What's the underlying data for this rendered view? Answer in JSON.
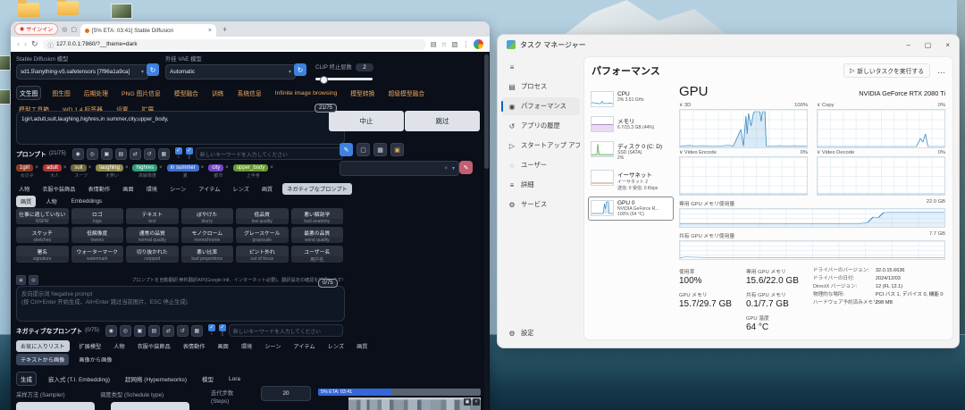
{
  "glyphs": {
    "back": "‹",
    "forward": "›",
    "reload": "↻",
    "info": "ⓘ",
    "star": "☆",
    "panel": "▤",
    "ext": "▧",
    "menu": "⋮",
    "plus": "+",
    "close": "×",
    "person": "◉",
    "circle": "◎",
    "box": "▢",
    "min": "–",
    "max": "▢",
    "hamburger": "≡",
    "gear": "⚙",
    "ellipsis": "…",
    "runtask": "▷",
    "check": "✓",
    "brush": "✎",
    "trash": "▦",
    "image": "▣",
    "swap": "⇄",
    "undo": "↺",
    "collapse": "◠",
    "expand": "▣"
  },
  "browser": {
    "signin_label": "サインイン",
    "tab_title": "[5% ETA: 03:41] Stable Diffusion",
    "url": "127.0.0.1:7860/?__theme=dark"
  },
  "sd": {
    "model_label": "Stable Diffusion 模型",
    "model_value": "sd1.5\\anything-v5.safetensors [7f96a1a9ca]",
    "vae_label": "外挂 VAE 模型",
    "vae_value": "Automatic",
    "clip_label": "CLIP 终止层数",
    "clip_value": "2",
    "tabs": [
      "文生图",
      "图生图",
      "后期处理",
      "PNG 图片信息",
      "模型融合",
      "训练",
      "系统信息",
      "Infinite image browsing",
      "模型转换",
      "超级模型融合",
      "模型工具箱",
      "WD 1.4 标签器",
      "设置",
      "扩展"
    ],
    "prompt_counter": "21/75",
    "prompt_text": "1girl,adult,suit,laughing,highres,in summer,city,upper_body,",
    "interrupt_label": "中止",
    "skip_label": "跳过",
    "prompt_header": "プロンプト",
    "prompt_header_count": "(21/75)",
    "neg_header": "ネガティブなプロンプト",
    "neg_header_count": "(0/75)",
    "keyword_placeholder": "新しいキーワードを入力してください",
    "header_icons": [
      "◉",
      "◎",
      "▣",
      "▤",
      "⇄",
      "↺",
      "▦"
    ],
    "toggles": [
      {
        "glyph": "○"
      },
      {
        "glyph": "▯"
      }
    ],
    "chips": [
      {
        "label": "1girl",
        "sub": "女の子",
        "color": "#8c3a28"
      },
      {
        "label": "adult",
        "sub": "大人",
        "color": "#b23434"
      },
      {
        "label": "suit",
        "sub": "スーツ",
        "color": "#6e6638"
      },
      {
        "label": "laughing",
        "sub": "大笑い",
        "color": "#8f8a4e"
      },
      {
        "label": "highres",
        "sub": "高解像度",
        "color": "#2f9d7c"
      },
      {
        "label": "in summer",
        "sub": "夏",
        "color": "#3d6fd2"
      },
      {
        "label": "city",
        "sub": "都市",
        "color": "#7446c9"
      },
      {
        "label": "upper_body",
        "sub": "上半身",
        "color": "#679a2e"
      }
    ],
    "category_tabs": [
      "人物",
      "衣服や装飾品",
      "表情動作",
      "画面",
      "環境",
      "シーン",
      "アイテム",
      "レンズ",
      "画質",
      "ネガティブなプロンプト"
    ],
    "subcat_tabs": [
      "画質",
      "人物",
      "Embeddings"
    ],
    "neg_grid": [
      {
        "jp": "仕事に適していない",
        "en": "NSFW"
      },
      {
        "jp": "ロゴ",
        "en": "logo"
      },
      {
        "jp": "テキスト",
        "en": "text"
      },
      {
        "jp": "ぼやけた",
        "en": "blurry"
      },
      {
        "jp": "低品質",
        "en": "low quality"
      },
      {
        "jp": "悪い解剖学",
        "en": "bad anatomy"
      },
      {
        "jp": "スケッチ",
        "en": "sketches"
      },
      {
        "jp": "低解像度",
        "en": "lowres"
      },
      {
        "jp": "通常の品質",
        "en": "normal quality"
      },
      {
        "jp": "モノクローム",
        "en": "monochrome"
      },
      {
        "jp": "グレースケール",
        "en": "grayscale"
      },
      {
        "jp": "最悪の品質",
        "en": "worst quality"
      },
      {
        "jp": "署名",
        "en": "signature"
      },
      {
        "jp": "ウォーターマーク",
        "en": "watermark"
      },
      {
        "jp": "切り抜かれた",
        "en": "cropped"
      },
      {
        "jp": "悪い比率",
        "en": "bad proportions"
      },
      {
        "jp": "ピント外れ",
        "en": "out of focus"
      },
      {
        "jp": "ユーザー名",
        "en": "用户名"
      }
    ],
    "hint_text": "プロンプトを自動翻訳:無料翻訳API(Google Intl、インターネット必要)。翻訳設定の確認を推奨します!",
    "neg_counter": "0/75",
    "neg_placeholder_1": "反向提示词 Negative prompt",
    "neg_placeholder_2": "(按 Ctrl+Enter 开始生成、Alt+Enter 跳过当前图片、ESC 停止生成)",
    "fav_tabs": [
      "お気に入りリスト",
      "扩展模型",
      "人物",
      "衣服や装飾品",
      "表情動作",
      "画面",
      "環境",
      "シーン",
      "アイテム",
      "レンズ",
      "画質"
    ],
    "mode_tabs": [
      "テキストから画像",
      "画像から画像"
    ],
    "bottom_tabs": [
      "生成",
      "嵌入式 (T.I. Embedding)",
      "超网络 (Hypernetworks)",
      "模型",
      "Lora"
    ],
    "sampler_label": "采样方法 (Sampler)",
    "schedule_label": "调度类型 (Schedule type)",
    "steps_label_1": "迭代步数",
    "steps_label_2": "(Steps)",
    "steps_value": "20",
    "progress_label": "5% ETA: 03:41"
  },
  "taskman": {
    "title": "タスク マネージャー",
    "header": "パフォーマンス",
    "run_task": "新しいタスクを実行する",
    "nav": [
      {
        "glyph": "▤",
        "label": "プロセス"
      },
      {
        "glyph": "◉",
        "label": "パフォーマンス"
      },
      {
        "glyph": "↺",
        "label": "アプリの履歴"
      },
      {
        "glyph": "▷",
        "label": "スタートアップ アプリ"
      },
      {
        "glyph": "◌",
        "label": "ユーザー"
      },
      {
        "glyph": "≡",
        "label": "詳細"
      },
      {
        "glyph": "⚙",
        "label": "サービス"
      }
    ],
    "settings_label": "設定",
    "perf": [
      {
        "name": "CPU",
        "l1": "2% 3.51 GHz",
        "l2": ""
      },
      {
        "name": "メモリ",
        "l1": "6.7/15.3 GB (44%)",
        "l2": ""
      },
      {
        "name": "ディスク 0 (C: D)",
        "l1": "SSD (SATA)",
        "l2": "2%"
      },
      {
        "name": "イーサネット",
        "l1": "イーサネット 2",
        "l2": "送信: 0 受信: 0 Kbps"
      },
      {
        "name": "GPU 0",
        "l1": "NVIDIA GeForce R...",
        "l2": "100% (64 °C)"
      }
    ],
    "gpu": {
      "title": "GPU",
      "device": "NVIDIA GeForce RTX 2080 Ti",
      "charts": [
        {
          "label": "∨ 3D",
          "value": "100%"
        },
        {
          "label": "∨ Copy",
          "value": "0%"
        },
        {
          "label": "∨ Video Encode",
          "value": "0%"
        },
        {
          "label": "∨ Video Decode",
          "value": "0%"
        }
      ],
      "mem1_label": "専用 GPU メモリ使用量",
      "mem1_max": "22.0 GB",
      "mem2_label": "共有 GPU メモリ使用量",
      "mem2_max": "7.7 GB",
      "stats_left": [
        {
          "label": "使用率",
          "value": "100%"
        },
        {
          "label": "GPU メモリ",
          "value": "15.7/29.7 GB"
        }
      ],
      "stats_mid": [
        {
          "label": "専用 GPU メモリ",
          "value": "15.6/22.0 GB"
        },
        {
          "label": "共有 GPU メモリ",
          "value": "0.1/7.7 GB"
        },
        {
          "label": "GPU 温度",
          "value": "64 °C"
        }
      ],
      "stats_right": [
        {
          "label": "ドライバーのバージョン:",
          "value": "32.0.15.6636"
        },
        {
          "label": "ドライバーの日付:",
          "value": "2024/12/03"
        },
        {
          "label": "DirectX バージョン:",
          "value": "12 (FL 12.1)"
        },
        {
          "label": "物理的な場所:",
          "value": "PCI バス 1, デバイス 0, 機能 0"
        },
        {
          "label": "ハードウェア予約済みメモリ:",
          "value": "298 MB"
        }
      ]
    }
  }
}
